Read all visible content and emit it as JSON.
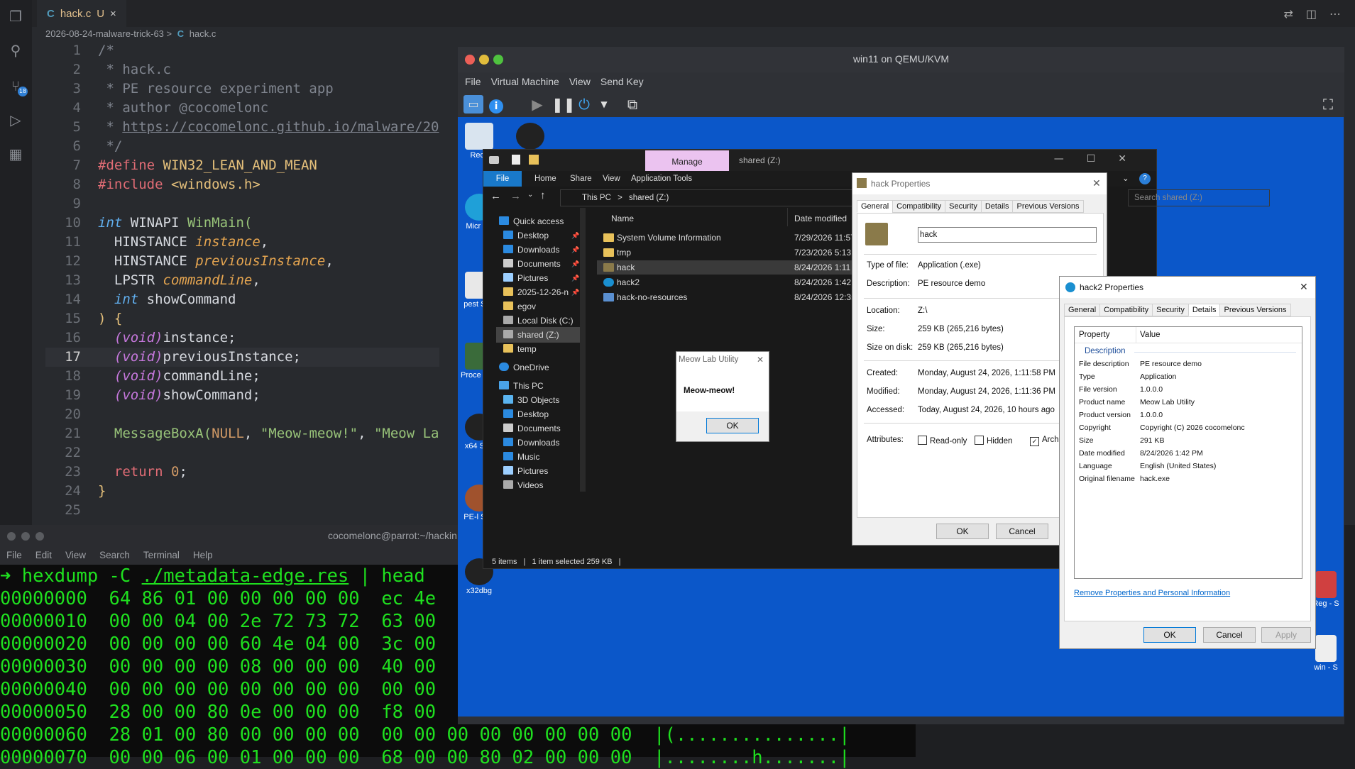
{
  "vscode": {
    "tab": {
      "icon": "C",
      "name": "hack.c",
      "status": "U",
      "close": "×"
    },
    "breadcrumb": {
      "folder": "2026-08-24-malware-trick-63",
      "sep": ">",
      "icon": "C",
      "file": "hack.c"
    },
    "activity_icons": [
      "files-icon",
      "search-icon",
      "source-control-icon",
      "run-debug-icon",
      "extensions-icon"
    ],
    "scm_badge": "18",
    "line_numbers": [
      "1",
      "2",
      "3",
      "4",
      "5",
      "6",
      "7",
      "8",
      "9",
      "10",
      "11",
      "12",
      "13",
      "14",
      "15",
      "16",
      "17",
      "18",
      "19",
      "20",
      "21",
      "22",
      "23",
      "24",
      "25"
    ],
    "code": {
      "l1": "/*",
      "l2": " * hack.c",
      "l3": " * PE resource experiment app",
      "l4": " * author @cocomelonc",
      "l5a": " * ",
      "l5b": "https://cocomelonc.github.io/malware/20",
      "l6": " */",
      "l7a": "#define",
      "l7b": " WIN32_LEAN_AND_MEAN",
      "l8a": "#include",
      "l8b": " <windows.h>",
      "l10a": "int",
      "l10b": " WINAPI ",
      "l10c": "WinMain(",
      "l11a": "  HINSTANCE ",
      "l11b": "instance",
      "l11c": ",",
      "l12a": "  HINSTANCE ",
      "l12b": "previousInstance",
      "l12c": ",",
      "l13a": "  LPSTR ",
      "l13b": "commandLine",
      "l13c": ",",
      "l14a": "  ",
      "l14b": "int",
      "l14c": " showCommand",
      "l15a": ") ",
      "l15b": "{",
      "l16a": "  ",
      "l16b": "(void)",
      "l16c": "instance;",
      "l17b": "(void)",
      "l17c": "previousInstance;",
      "l18b": "(void)",
      "l18c": "commandLine;",
      "l19b": "(void)",
      "l19c": "showCommand;",
      "l21a": "  MessageBoxA(",
      "l21b": "NULL",
      "l21c": ", ",
      "l21d": "\"Meow-meow!\"",
      "l21e": ", ",
      "l21f": "\"Meow La",
      "l23a": "  ",
      "l23b": "return",
      "l23c": " ",
      "l23d": "0",
      "l23e": ";",
      "l24": "}"
    }
  },
  "terminal": {
    "title": "cocomelonc@parrot:~/hackin",
    "menu": [
      "File",
      "Edit",
      "View",
      "Search",
      "Terminal",
      "Help"
    ],
    "prompt": "➜",
    "command_a": " hexdump -C ",
    "command_b": "./metadata-edge.res",
    "command_c": " | head",
    "rows": [
      "00000000  64 86 01 00 00 00 00 00  ec 4e",
      "00000010  00 00 04 00 2e 72 73 72  63 00",
      "00000020  00 00 00 00 60 4e 04 00  3c 00",
      "00000030  00 00 00 00 08 00 00 00  40 00",
      "00000040  00 00 00 00 00 00 00 00  00 00",
      "00000050  28 00 00 80 0e 00 00 00  f8 00",
      "00000060  28 01 00 80 00 00 00 00  00 00 00 00 00 00 00 00  |(...............|",
      "00000070  00 00 06 00 01 00 00 00  68 00 00 80 02 00 00 00  |........h.......|"
    ]
  },
  "vm": {
    "title": "win11 on QEMU/KVM",
    "menu": [
      "File",
      "Virtual Machine",
      "View",
      "Send Key"
    ],
    "desktop_icons": [
      {
        "name": "recycle-bin",
        "label": "Recy"
      },
      {
        "name": "bug",
        "label": ""
      },
      {
        "name": "edge",
        "label": "Micr Ed"
      },
      {
        "name": "pestudio",
        "label": "pest Sho"
      },
      {
        "name": "procexp",
        "label": "Proce - Sh"
      },
      {
        "name": "x64dbg",
        "label": "x64 Sho"
      },
      {
        "name": "pebear",
        "label": "PE-l Sho"
      },
      {
        "name": "x32dbg",
        "label": "x32dbg"
      },
      {
        "name": "regshot",
        "label": "Reg - S"
      },
      {
        "name": "winobj",
        "label": "win - S"
      }
    ]
  },
  "explorer": {
    "manage": "Manage",
    "title": "shared (Z:)",
    "ribbon": [
      "File",
      "Home",
      "Share",
      "View",
      "Application Tools"
    ],
    "address": [
      "This PC",
      ">",
      "shared (Z:)"
    ],
    "search_placeholder": "Search shared (Z:)",
    "nav": [
      {
        "label": "Quick access",
        "color": "#2b8ae0"
      },
      {
        "label": "Desktop",
        "color": "#2b8ae0"
      },
      {
        "label": "Downloads",
        "color": "#2b8ae0"
      },
      {
        "label": "Documents",
        "color": "#ccc"
      },
      {
        "label": "Pictures",
        "color": "#9ccfff"
      },
      {
        "label": "2025-12-26-n",
        "color": "#e8c15a"
      },
      {
        "label": "egov",
        "color": "#e8c15a"
      },
      {
        "label": "Local Disk (C:)",
        "color": "#aaa"
      },
      {
        "label": "shared (Z:)",
        "color": "#aaa"
      },
      {
        "label": "temp",
        "color": "#e8c15a"
      },
      {
        "label": "OneDrive",
        "color": "#2b8ae0"
      },
      {
        "label": "This PC",
        "color": "#4aa3e8"
      },
      {
        "label": "3D Objects",
        "color": "#5ab4f0"
      },
      {
        "label": "Desktop",
        "color": "#2b8ae0"
      },
      {
        "label": "Documents",
        "color": "#ccc"
      },
      {
        "label": "Downloads",
        "color": "#2b8ae0"
      },
      {
        "label": "Music",
        "color": "#2b8ae0"
      },
      {
        "label": "Pictures",
        "color": "#9ccfff"
      },
      {
        "label": "Videos",
        "color": "#aaa"
      }
    ],
    "pin": "📌",
    "col_name": "Name",
    "col_date": "Date modified",
    "files": [
      {
        "name": "System Volume Information",
        "date": "7/29/2026 11:57",
        "color": "#e8c15a"
      },
      {
        "name": "tmp",
        "date": "7/23/2026 5:13 A",
        "color": "#e8c15a"
      },
      {
        "name": "hack",
        "date": "8/24/2026 1:11",
        "color": "#8a7a4a"
      },
      {
        "name": "hack2",
        "date": "8/24/2026 1:42 P",
        "color": "#1a8fd0"
      },
      {
        "name": "hack-no-resources",
        "date": "8/24/2026 12:35",
        "color": "#5a8fd0"
      }
    ],
    "status": [
      "5 items",
      "|",
      "1 item selected  259 KB",
      "|"
    ]
  },
  "msgbox": {
    "title": "Meow Lab Utility",
    "text": "Meow-meow!",
    "ok": "OK",
    "close": "✕"
  },
  "hack_props": {
    "title": "hack Properties",
    "tabs": [
      "General",
      "Compatibility",
      "Security",
      "Details",
      "Previous Versions"
    ],
    "name_value": "hack",
    "rows": [
      {
        "label": "Type of file:",
        "value": "Application (.exe)"
      },
      {
        "label": "Description:",
        "value": "PE resource demo"
      },
      {
        "label": "Location:",
        "value": "Z:\\"
      },
      {
        "label": "Size:",
        "value": "259 KB (265,216 bytes)"
      },
      {
        "label": "Size on disk:",
        "value": "259 KB (265,216 bytes)"
      },
      {
        "label": "Created:",
        "value": "Monday, August 24, 2026, 1:11:58 PM"
      },
      {
        "label": "Modified:",
        "value": "Monday, August 24, 2026, 1:11:36 PM"
      },
      {
        "label": "Accessed:",
        "value": "Today, August 24, 2026, 10 hours ago"
      }
    ],
    "attributes_label": "Attributes:",
    "readonly": "Read-only",
    "hidden": "Hidden",
    "archive": "Archi",
    "ok": "OK",
    "cancel": "Cancel",
    "close": "✕"
  },
  "hack2_props": {
    "title": "hack2 Properties",
    "tabs": [
      "General",
      "Compatibility",
      "Security",
      "Details",
      "Previous Versions"
    ],
    "col_property": "Property",
    "col_value": "Value",
    "section": "Description",
    "rows": [
      {
        "label": "File description",
        "value": "PE resource demo"
      },
      {
        "label": "Type",
        "value": "Application"
      },
      {
        "label": "File version",
        "value": "1.0.0.0"
      },
      {
        "label": "Product name",
        "value": "Meow Lab Utility"
      },
      {
        "label": "Product version",
        "value": "1.0.0.0"
      },
      {
        "label": "Copyright",
        "value": "Copyright (C) 2026 cocomelonc"
      },
      {
        "label": "Size",
        "value": "291 KB"
      },
      {
        "label": "Date modified",
        "value": "8/24/2026 1:42 PM"
      },
      {
        "label": "Language",
        "value": "English (United States)"
      },
      {
        "label": "Original filename",
        "value": "hack.exe"
      }
    ],
    "remove_link": "Remove Properties and Personal Information",
    "ok": "OK",
    "cancel": "Cancel",
    "apply": "Apply",
    "close": "✕"
  }
}
